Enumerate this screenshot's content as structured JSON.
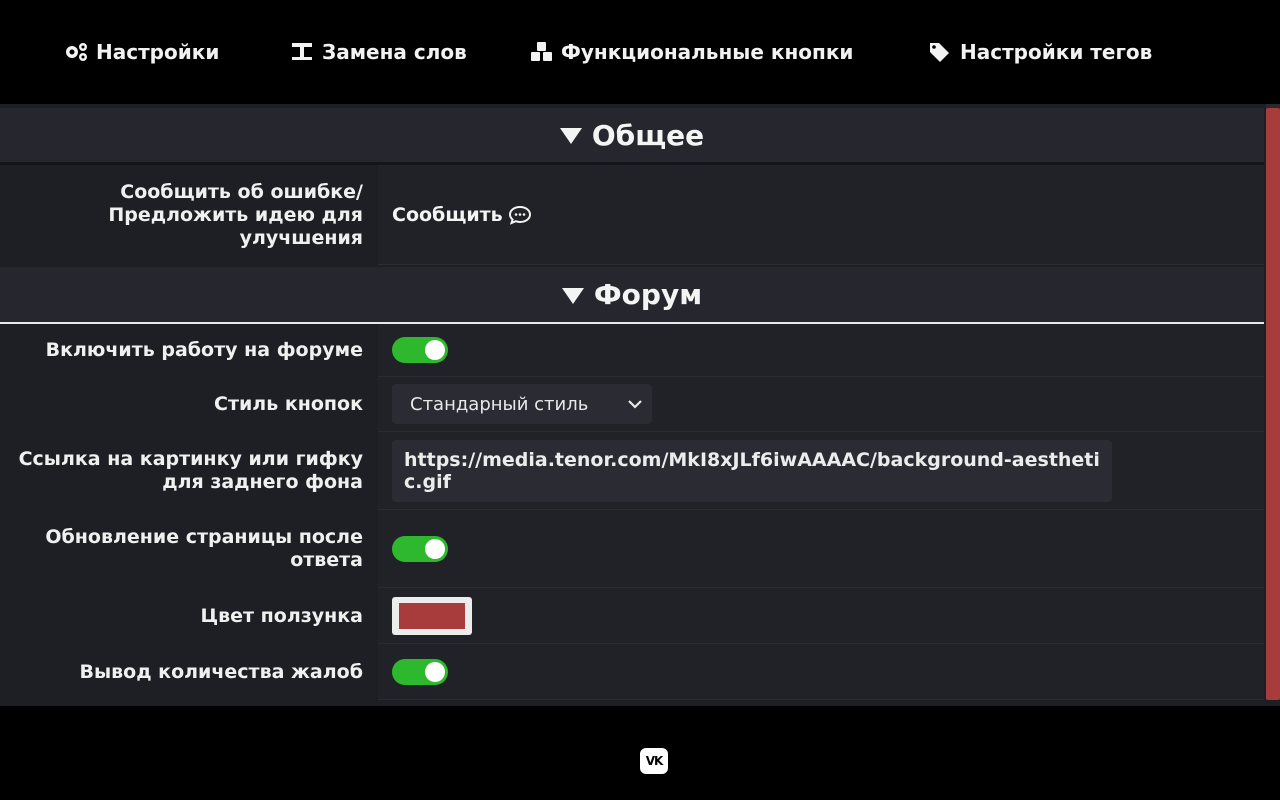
{
  "nav": {
    "items": [
      {
        "label": "Настройки",
        "icon": "gears-icon"
      },
      {
        "label": "Замена слов",
        "icon": "text-replace-icon"
      },
      {
        "label": "Функциональные кнопки",
        "icon": "cubes-icon"
      },
      {
        "label": "Настройки тегов",
        "icon": "tags-icon"
      }
    ]
  },
  "sections": {
    "general": {
      "title": "Общее"
    },
    "forum": {
      "title": "Форум"
    }
  },
  "general": {
    "report_label": "Сообщить об ошибке/ Предложить идею для улучшения",
    "report_link": "Сообщить"
  },
  "forum": {
    "enable_label": "Включить работу на форуме",
    "enable_value": true,
    "button_style_label": "Стиль кнопок",
    "button_style_value": "Стандарный стиль",
    "bg_label": "Ссылка на картинку или гифку для заднего фона",
    "bg_value": "https://media.tenor.com/MkI8xJLf6iwAAAAC/background-aesthetic.gif",
    "refresh_label": "Обновление страницы после ответа",
    "refresh_value": true,
    "slider_color_label": "Цвет ползунка",
    "slider_color_value": "#a83b3b",
    "complaints_label": "Вывод количества жалоб",
    "complaints_value": true
  },
  "footer": {
    "vk_label": "VK"
  },
  "colors": {
    "accent": "#a83b3b",
    "toggle_on": "#2eb82e",
    "panel_bg": "#1e1f24"
  }
}
